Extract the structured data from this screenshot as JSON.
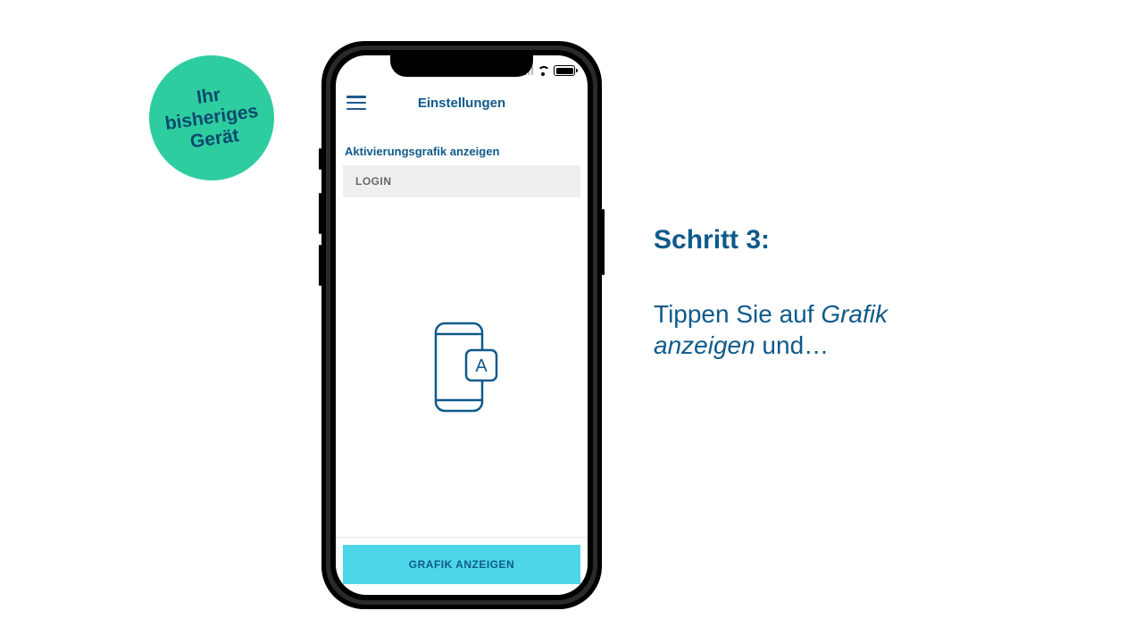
{
  "badge": {
    "line1": "Ihr",
    "line2": "bisheriges",
    "line3": "Gerät"
  },
  "phone": {
    "header_title": "Einstellungen",
    "section_header": "Aktivierungsgrafik anzeigen",
    "login_label": "LOGIN",
    "button_label": "GRAFIK ANZEIGEN",
    "graphic_letter": "A"
  },
  "instructions": {
    "title": "Schritt 3:",
    "body_pre": "Tippen Sie auf ",
    "body_italic": "Grafik anzeigen",
    "body_post": " und…"
  },
  "colors": {
    "badge_bg": "#2ecda0",
    "accent": "#0f5a8a",
    "button_bg": "#4dd6e8"
  }
}
